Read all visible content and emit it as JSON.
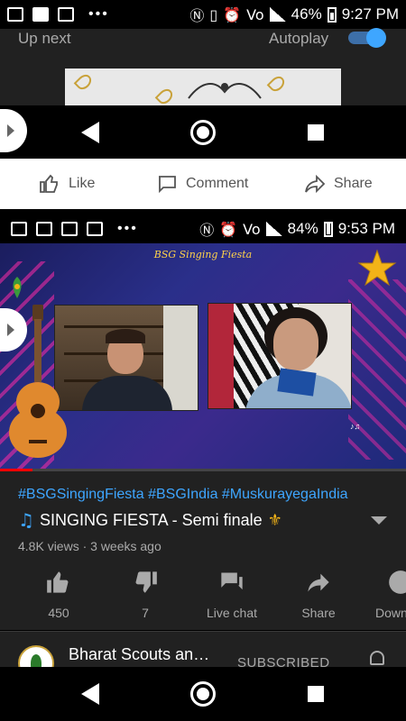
{
  "outer_status": {
    "battery": "46%",
    "time": "9:27 PM",
    "network": "LTE"
  },
  "up_next": {
    "label": "Up next",
    "autoplay_label": "Autoplay",
    "autoplay_on": true
  },
  "post_actions": {
    "like": "Like",
    "comment": "Comment",
    "share": "Share"
  },
  "inner_status": {
    "battery": "84%",
    "time": "9:53 PM",
    "network": "LTE"
  },
  "video": {
    "overlay_title": "BSG Singing Fiesta",
    "progress": 0.08,
    "hashtags": "#BSGSingingFiesta #BSGIndia #MuskurayegaIndia",
    "title": "SINGING FIESTA - Semi finale",
    "meta": "4.8K views · 3 weeks ago",
    "actions": {
      "like_count": "450",
      "dislike_count": "7",
      "live_chat": "Live chat",
      "share": "Share",
      "download": "Down"
    }
  },
  "channel": {
    "name": "Bharat Scouts an…",
    "subscribed_label": "SUBSCRIBED"
  },
  "colors": {
    "accent_blue": "#3ea6ff",
    "dark_bg": "#212121",
    "progress_red": "#ff0000"
  }
}
